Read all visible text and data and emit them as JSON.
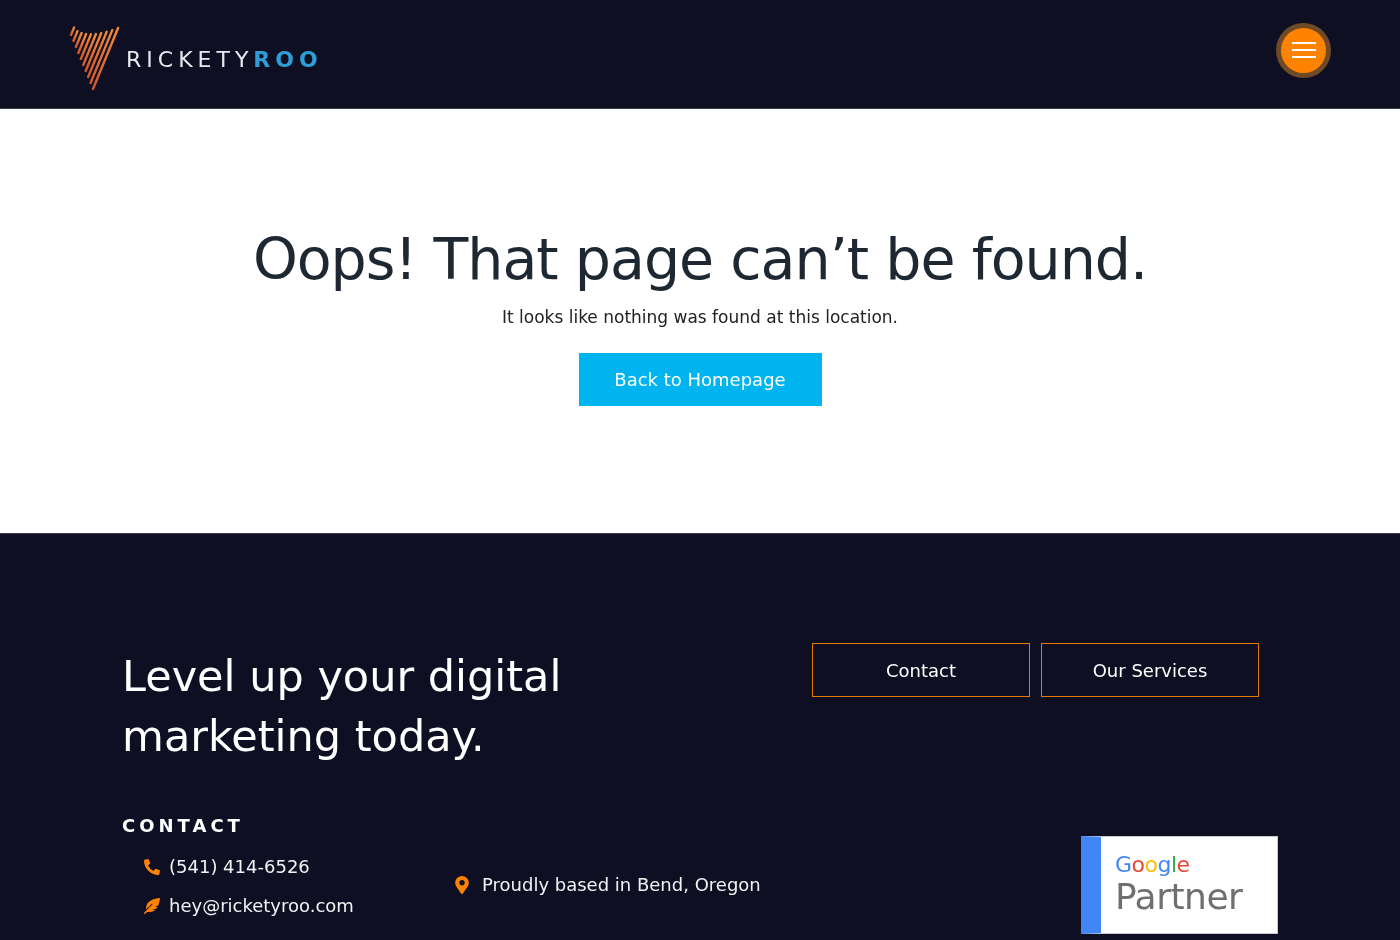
{
  "header": {
    "logo": {
      "text_1": "RICKETY",
      "text_2": "ROO"
    }
  },
  "main": {
    "title": "Oops! That page can’t be found.",
    "message": "It looks like nothing was found at this location.",
    "button": "Back to Homepage"
  },
  "footer": {
    "tagline": "Level up your digital marketing today.",
    "buttons": [
      "Contact",
      "Our Services"
    ],
    "contact_heading": "CONTACT",
    "contacts": [
      {
        "kind": "phone",
        "text": "(541) 414-6526"
      },
      {
        "kind": "email",
        "text": "hey@ricketyroo.com"
      }
    ],
    "location": "Proudly based in Bend, Oregon",
    "badge": {
      "brand": "Google",
      "label": "Partner"
    }
  }
}
